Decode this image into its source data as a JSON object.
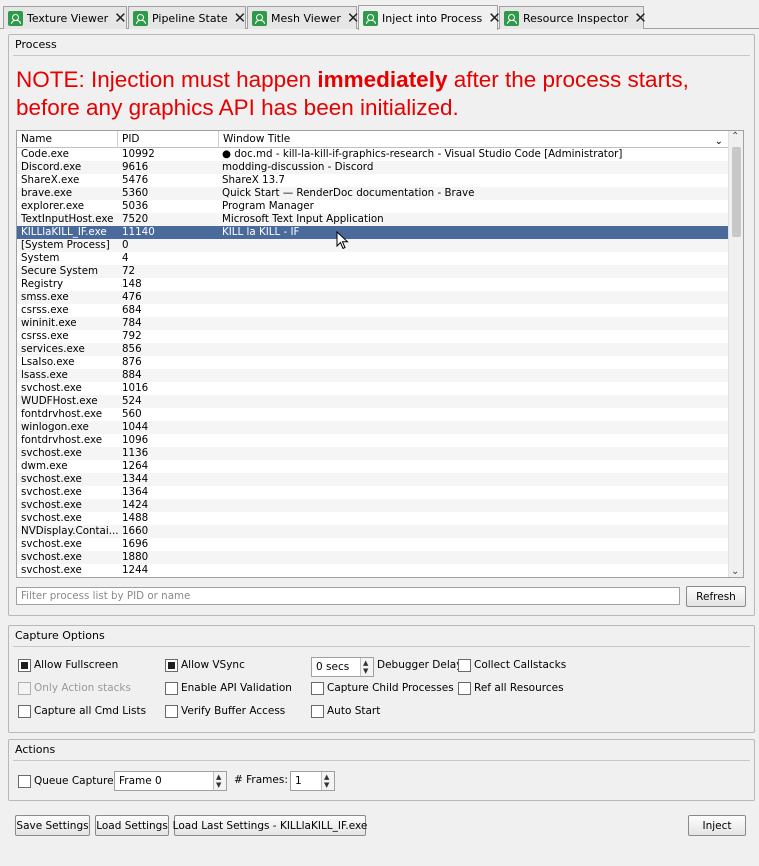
{
  "tabs": [
    {
      "label": "Texture Viewer",
      "active": false
    },
    {
      "label": "Pipeline State",
      "active": false
    },
    {
      "label": "Mesh Viewer",
      "active": false
    },
    {
      "label": "Inject into Process",
      "active": true
    },
    {
      "label": "Resource Inspector",
      "active": false
    }
  ],
  "process_group": {
    "title": "Process",
    "note_prefix": "NOTE: Injection must happen ",
    "note_emphasis": "immediately",
    "note_suffix": " after the process starts, before any graphics API has been initialized.",
    "columns": {
      "name": "Name",
      "pid": "PID",
      "title": "Window Title"
    },
    "rows": [
      {
        "name": "Code.exe",
        "pid": "10992",
        "title": "● doc.md - kill-la-kill-if-graphics-research - Visual Studio Code [Administrator]"
      },
      {
        "name": "Discord.exe",
        "pid": "9616",
        "title": "modding-discussion - Discord"
      },
      {
        "name": "ShareX.exe",
        "pid": "5476",
        "title": "ShareX 13.7"
      },
      {
        "name": "brave.exe",
        "pid": "5360",
        "title": "Quick Start — RenderDoc documentation - Brave"
      },
      {
        "name": "explorer.exe",
        "pid": "5036",
        "title": "Program Manager"
      },
      {
        "name": "TextInputHost.exe",
        "pid": "7520",
        "title": "Microsoft Text Input Application"
      },
      {
        "name": "KILLlaKILL_IF.exe",
        "pid": "11140",
        "title": "KILL la KILL - IF",
        "selected": true
      },
      {
        "name": "[System Process]",
        "pid": "0",
        "title": ""
      },
      {
        "name": "System",
        "pid": "4",
        "title": ""
      },
      {
        "name": "Secure System",
        "pid": "72",
        "title": ""
      },
      {
        "name": "Registry",
        "pid": "148",
        "title": ""
      },
      {
        "name": "smss.exe",
        "pid": "476",
        "title": ""
      },
      {
        "name": "csrss.exe",
        "pid": "684",
        "title": ""
      },
      {
        "name": "wininit.exe",
        "pid": "784",
        "title": ""
      },
      {
        "name": "csrss.exe",
        "pid": "792",
        "title": ""
      },
      {
        "name": "services.exe",
        "pid": "856",
        "title": ""
      },
      {
        "name": "LsaIso.exe",
        "pid": "876",
        "title": ""
      },
      {
        "name": "lsass.exe",
        "pid": "884",
        "title": ""
      },
      {
        "name": "svchost.exe",
        "pid": "1016",
        "title": ""
      },
      {
        "name": "WUDFHost.exe",
        "pid": "524",
        "title": ""
      },
      {
        "name": "fontdrvhost.exe",
        "pid": "560",
        "title": ""
      },
      {
        "name": "winlogon.exe",
        "pid": "1044",
        "title": ""
      },
      {
        "name": "fontdrvhost.exe",
        "pid": "1096",
        "title": ""
      },
      {
        "name": "svchost.exe",
        "pid": "1136",
        "title": ""
      },
      {
        "name": "dwm.exe",
        "pid": "1264",
        "title": ""
      },
      {
        "name": "svchost.exe",
        "pid": "1344",
        "title": ""
      },
      {
        "name": "svchost.exe",
        "pid": "1364",
        "title": ""
      },
      {
        "name": "svchost.exe",
        "pid": "1424",
        "title": ""
      },
      {
        "name": "svchost.exe",
        "pid": "1488",
        "title": ""
      },
      {
        "name": "NVDisplay.Contai...",
        "pid": "1660",
        "title": ""
      },
      {
        "name": "svchost.exe",
        "pid": "1696",
        "title": ""
      },
      {
        "name": "svchost.exe",
        "pid": "1880",
        "title": ""
      },
      {
        "name": "svchost.exe",
        "pid": "1244",
        "title": ""
      }
    ],
    "filter_placeholder": "Filter process list by PID or name",
    "refresh_label": "Refresh"
  },
  "capture_options": {
    "title": "Capture Options",
    "allow_fullscreen": "Allow Fullscreen",
    "allow_vsync": "Allow VSync",
    "debugger_delay_value": "0 secs",
    "debugger_delay_label": "Debugger Delay",
    "collect_callstacks": "Collect Callstacks",
    "only_action_stacks": "Only Action stacks",
    "enable_api_validation": "Enable API Validation",
    "capture_child_processes": "Capture Child Processes",
    "ref_all_resources": "Ref all Resources",
    "capture_all_cmd_lists": "Capture all Cmd Lists",
    "verify_buffer_access": "Verify Buffer Access",
    "auto_start": "Auto Start"
  },
  "actions": {
    "title": "Actions",
    "queue_capture": "Queue Capture",
    "frame_value": "Frame 0",
    "frames_label": "# Frames:",
    "frames_value": "1"
  },
  "bottom": {
    "save_settings": "Save Settings",
    "load_settings": "Load Settings",
    "load_last_settings": "Load Last Settings - KILLlaKILL_IF.exe",
    "inject": "Inject"
  }
}
